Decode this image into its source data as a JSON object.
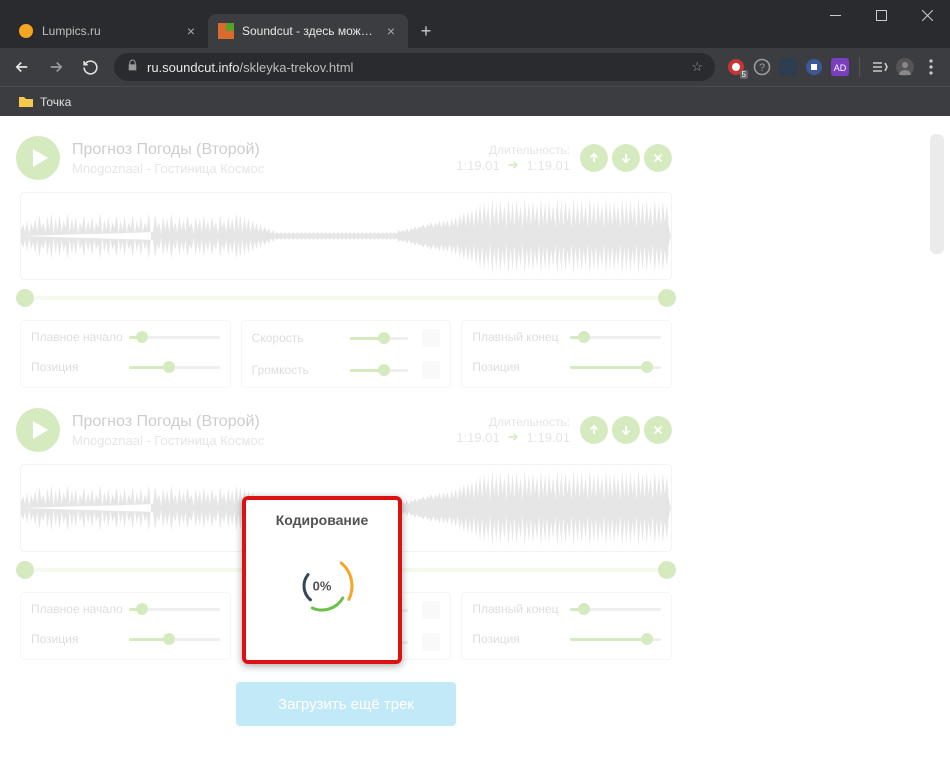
{
  "browser": {
    "tabs": {
      "inactive_title": "Lumpics.ru",
      "active_title": "Soundcut - здесь можно обрезать"
    },
    "url_domain": "ru.soundcut.info",
    "url_path": "/skleyka-trekov.html",
    "bookmark": "Точка",
    "ext_badge": "5"
  },
  "track": {
    "title": "Прогноз Погоды (Второй)",
    "artist": "Mnogoznaal - Гостиница Космос",
    "duration_label": "Длительность:",
    "duration_from": "1:19.01",
    "duration_to": "1:19.01"
  },
  "controls": {
    "fade_in": "Плавное начало",
    "position": "Позиция",
    "speed": "Скорость",
    "volume": "Громкость",
    "fade_out": "Плавный конец"
  },
  "modal": {
    "title": "Кодирование",
    "progress": "0%"
  },
  "load_button": "Загрузить ещё трек"
}
